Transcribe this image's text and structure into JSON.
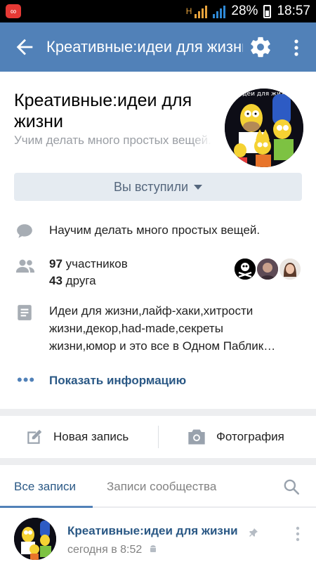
{
  "status_bar": {
    "battery": "28%",
    "time": "18:57",
    "network": "H"
  },
  "app_bar": {
    "title": "Креативные:идеи для жизни",
    "back_icon": "arrow-left-icon",
    "settings_icon": "gear-icon",
    "more_icon": "more-vert-icon"
  },
  "group": {
    "name": "Креативные:идеи для жизни",
    "status": "Учим делать много простых вещей.",
    "avatar_caption": "идеи для жизни",
    "join_button": "Вы вступили",
    "description": "Научим делать много простых вещей.",
    "members_count": "97",
    "members_label": "участников",
    "friends_count": "43",
    "friends_label": "друга",
    "about": "Идеи для жизни,лайф-хаки,хитрости жизни,декор,had-made,секреты жизни,юмор и это все в Одном Паблик…",
    "show_info": "Показать информацию"
  },
  "actions": {
    "new_post": "Новая запись",
    "photo": "Фотография"
  },
  "tabs": {
    "all_posts": "Все записи",
    "community_posts": "Записи сообщества"
  },
  "post": {
    "author": "Креативные:идеи для жизни",
    "time": "сегодня в 8:52"
  },
  "colors": {
    "accent": "#5181b8",
    "link": "#2a5885",
    "header": "#5181b8",
    "background": "#edeef0"
  }
}
